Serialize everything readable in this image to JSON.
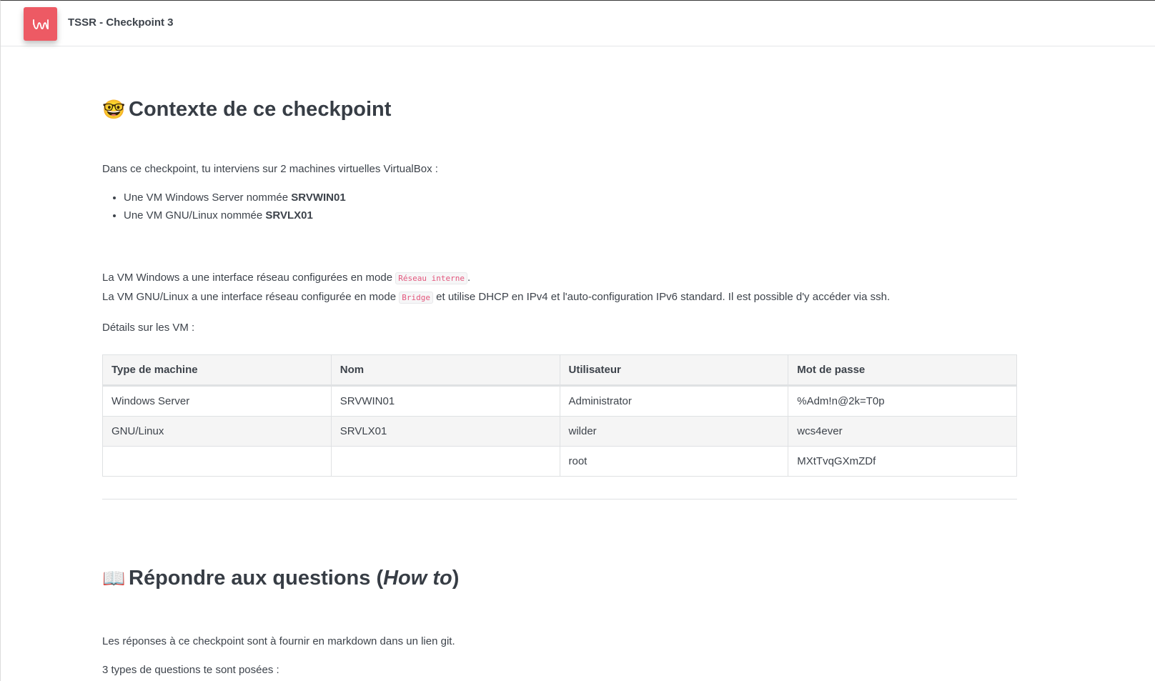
{
  "app": {
    "title": "TSSR - Checkpoint 3"
  },
  "section1": {
    "emoji": "🤓",
    "title": "Contexte de ce checkpoint",
    "intro": "Dans ce checkpoint, tu interviens sur 2 machines virtuelles VirtualBox :",
    "bullets": [
      {
        "prefix": "Une VM Windows Server nommée ",
        "bold": "SRVWIN01"
      },
      {
        "prefix": "Une VM GNU/Linux nommée ",
        "bold": "SRVLX01"
      }
    ],
    "line1": {
      "prefix": "La VM Windows a une interface réseau configurées en mode ",
      "code": "Réseau interne",
      "suffix": "."
    },
    "line2": {
      "prefix": "La VM GNU/Linux a une interface réseau configurée en mode ",
      "code": "Bridge",
      "suffix": " et utilise DHCP en IPv4 et l'auto-configuration IPv6 standard. Il est possible d'y accéder via ssh."
    },
    "details_label": "Détails sur les VM :",
    "table": {
      "headers": [
        "Type de machine",
        "Nom",
        "Utilisateur",
        "Mot de passe"
      ],
      "rows": [
        [
          "Windows Server",
          "SRVWIN01",
          "Administrator",
          "%Adm!n@2k=T0p"
        ],
        [
          "GNU/Linux",
          "SRVLX01",
          "wilder",
          "wcs4ever"
        ],
        [
          "",
          "",
          "root",
          "MXtTvqGXmZDf"
        ]
      ]
    }
  },
  "section2": {
    "emoji": "📖",
    "title_prefix": "Répondre aux questions (",
    "title_italic": "How to",
    "title_suffix": ")",
    "intro": "Les réponses à ce checkpoint sont à fournir en markdown dans un lien git.",
    "partial": "3 types de questions te sont posées :"
  },
  "colors": {
    "brand": "#ed5a64",
    "code_text": "#e3577d",
    "text": "#3d434b"
  }
}
